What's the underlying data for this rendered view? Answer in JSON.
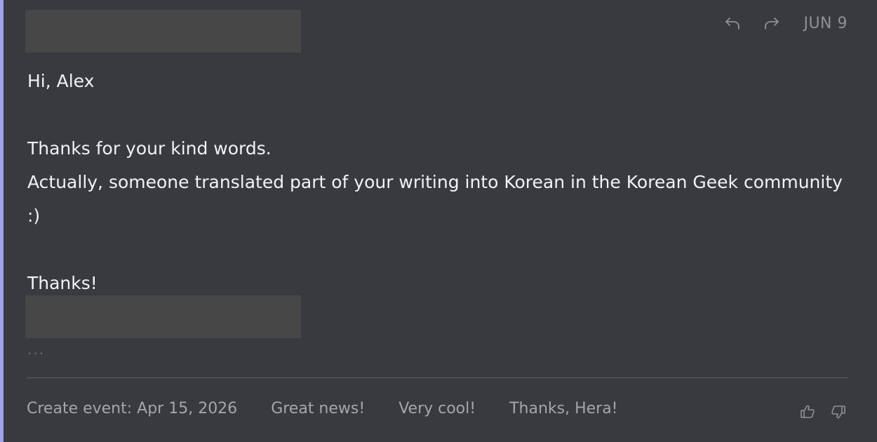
{
  "header": {
    "reply_icon": "reply-icon",
    "forward_icon": "forward-icon",
    "date": "JUN 9"
  },
  "message": {
    "greeting": "Hi, Alex",
    "line1": "Thanks for your kind words.",
    "line2": "Actually, someone translated part of your writing into Korean in the Korean Geek community",
    "line3": ":)",
    "signoff": "Thanks!",
    "more": "..."
  },
  "suggestions": [
    "Create event: Apr 15, 2026",
    "Great news!",
    "Very cool!",
    "Thanks, Hera!"
  ],
  "feedback": {
    "thumbs_up_icon": "thumbs-up-icon",
    "thumbs_down_icon": "thumbs-down-icon"
  },
  "colors": {
    "background": "#383a3f",
    "accent": "#9ea3e8",
    "redaction": "#474747",
    "text": "#f1f2f4",
    "muted": "#8e9196"
  }
}
